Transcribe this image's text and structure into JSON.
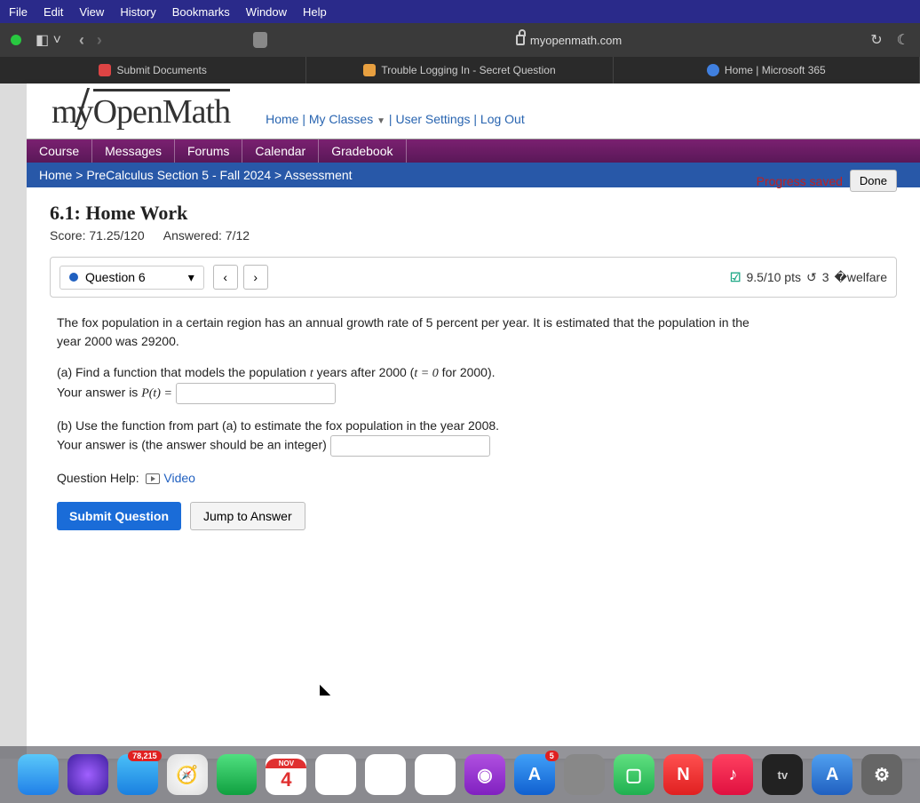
{
  "mac_menu": [
    "File",
    "Edit",
    "View",
    "History",
    "Bookmarks",
    "Window",
    "Help"
  ],
  "browser": {
    "url": "myopenmath.com"
  },
  "tabs": [
    {
      "label": "Submit Documents"
    },
    {
      "label": "Trouble Logging In - Secret Question"
    },
    {
      "label": "Home | Microsoft 365"
    }
  ],
  "site": {
    "logo_prefix": "my",
    "logo_main": "OpenMath",
    "nav_home": "Home",
    "nav_classes": "My Classes",
    "nav_settings": "User Settings",
    "nav_logout": "Log Out"
  },
  "course_tabs": [
    "Course",
    "Messages",
    "Forums",
    "Calendar",
    "Gradebook"
  ],
  "breadcrumb": {
    "home": "Home",
    "course": "PreCalculus Section 5 - Fall 2024",
    "page": "Assessment"
  },
  "assignment": {
    "title": "6.1: Home Work",
    "score_label": "Score: 71.25/120",
    "answered_label": "Answered: 7/12",
    "progress_text": "Progress saved",
    "done": "Done"
  },
  "question_bar": {
    "label": "Question 6",
    "score": "9.5/10 pts",
    "attempts": "3"
  },
  "question": {
    "intro": "The fox population in a certain region has an annual growth rate of 5 percent per year. It is estimated that the population in the year 2000 was 29200.",
    "part_a": "(a) Find a function that models the population ",
    "part_a_mid": " years after 2000 (",
    "part_a_end": " for 2000).",
    "ans_a_label": "Your answer is ",
    "p_of_t": "P(t) =",
    "t_eq": "t = 0",
    "t_var": "t",
    "part_b": "(b) Use the function from part (a) to estimate the fox population in the year 2008.",
    "ans_b_label": "Your answer is (the answer should be an integer)",
    "help_label": "Question Help:",
    "video": "Video",
    "submit": "Submit Question",
    "jump": "Jump to Answer"
  },
  "dock": {
    "mail_badge": "78,215",
    "cal_month": "NOV",
    "cal_day": "4",
    "appstore_badge": "5",
    "tv": "tv"
  }
}
